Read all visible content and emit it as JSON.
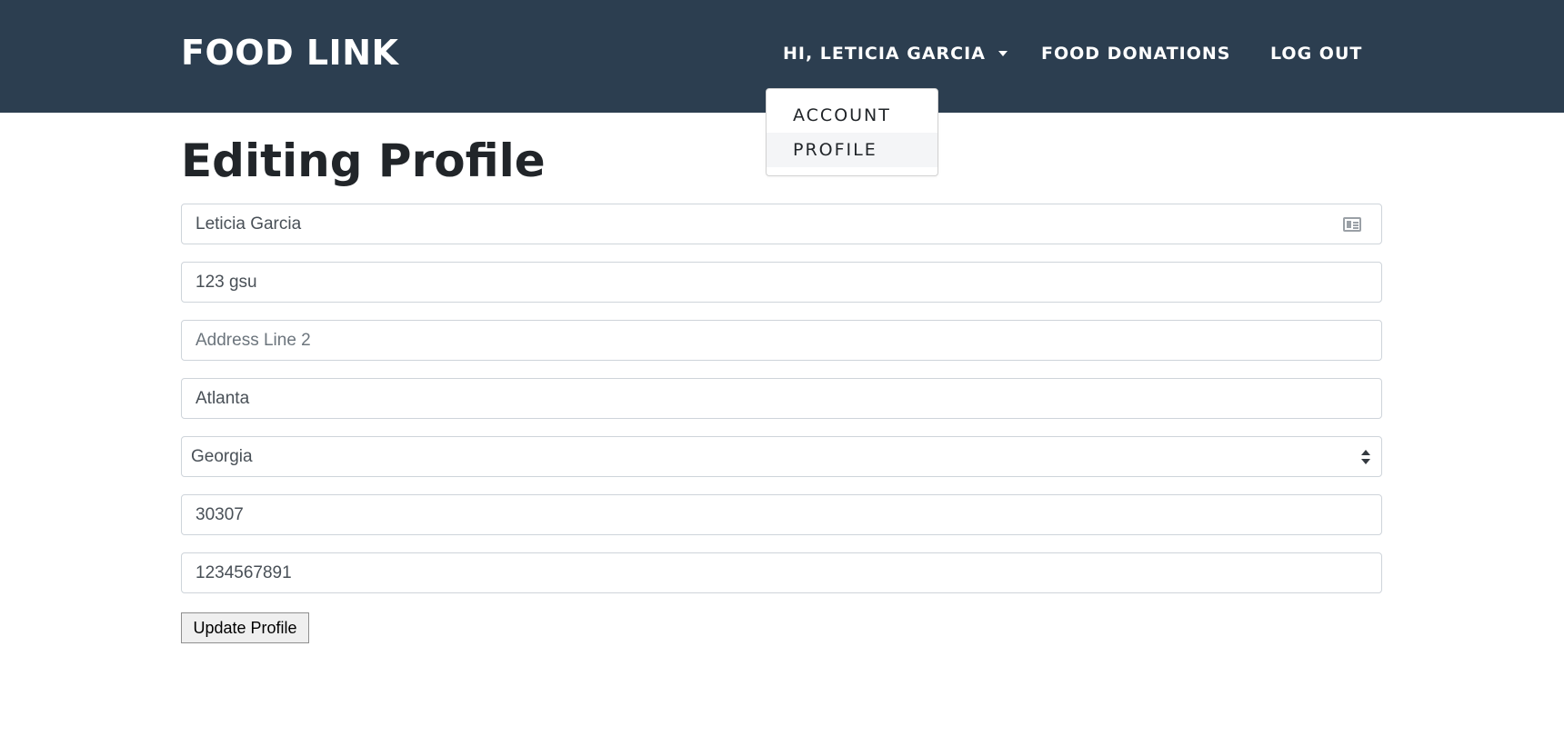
{
  "navbar": {
    "brand": "FOOD LINK",
    "user_menu_label": "HI, LETICIA GARCIA",
    "donations_label": "FOOD DONATIONS",
    "logout_label": "LOG OUT",
    "dropdown": [
      "ACCOUNT",
      "PROFILE"
    ],
    "active_dropdown_item": "PROFILE",
    "bg_color": "#2c3e50"
  },
  "page": {
    "title": "Editing Profile"
  },
  "form": {
    "name": "Leticia Garcia",
    "address_line1": "123 gsu",
    "address_line2": "",
    "address_line2_placeholder": "Address Line 2",
    "city": "Atlanta",
    "state": "Georgia",
    "zip": "30307",
    "phone": "1234567891",
    "submit_label": "Update Profile",
    "name_field_icon": "contact-card-icon",
    "state_select_icon": "select-arrows-icon"
  }
}
